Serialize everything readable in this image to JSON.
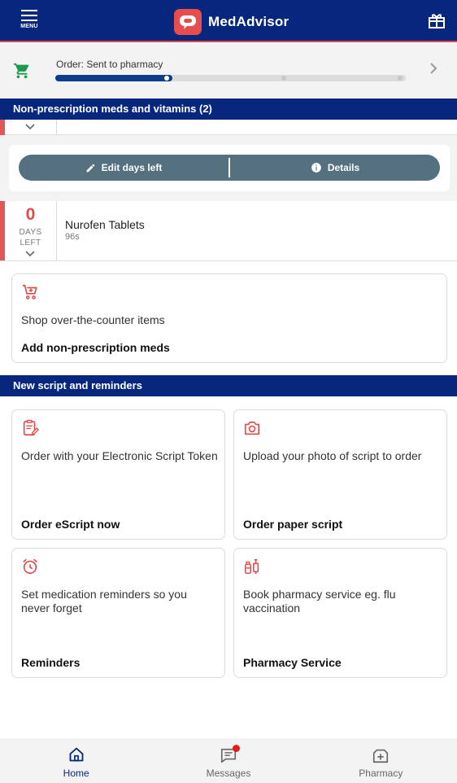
{
  "header": {
    "menu_label": "MENU",
    "brand_name": "MedAdvisor",
    "gift_icon": "gift-icon",
    "colors": {
      "background": "#06277d",
      "brand_logo": "#e84d4d",
      "accent_line": "#e14b4b"
    }
  },
  "order": {
    "label": "Order: Sent to pharmacy",
    "progress_percent": 33
  },
  "non_prescription": {
    "section_title": "Non-prescription meds and vitamins (2)",
    "actions": {
      "edit_label": "Edit days left",
      "details_label": "Details"
    },
    "med": {
      "days_count": "0",
      "days_label_line1": "DAYS",
      "days_label_line2": "LEFT",
      "name": "Nurofen Tablets",
      "quantity": "96s"
    },
    "shop_card": {
      "description": "Shop over-the-counter items",
      "title": "Add non-prescription meds"
    }
  },
  "new_script": {
    "section_title": "New script and reminders",
    "cards": [
      {
        "icon": "escript-icon",
        "description": "Order with your Electronic Script Token",
        "title": "Order eScript now"
      },
      {
        "icon": "camera-icon",
        "description": "Upload your photo of script to order",
        "title": "Order paper script"
      },
      {
        "icon": "alarm-clock-icon",
        "description_line1": "Set medication reminders so you",
        "description_line2": "never forget",
        "title": "Reminders"
      },
      {
        "icon": "vaccine-icon",
        "description_line1": "Book pharmacy service eg. flu",
        "description_line2": "vaccination",
        "title": "Pharmacy Service"
      }
    ]
  },
  "bottom_nav": {
    "items": [
      {
        "label": "Home",
        "icon": "home-icon",
        "active": true
      },
      {
        "label": "Messages",
        "icon": "messages-icon",
        "has_badge": true
      },
      {
        "label": "Pharmacy",
        "icon": "pharmacy-icon"
      }
    ]
  }
}
